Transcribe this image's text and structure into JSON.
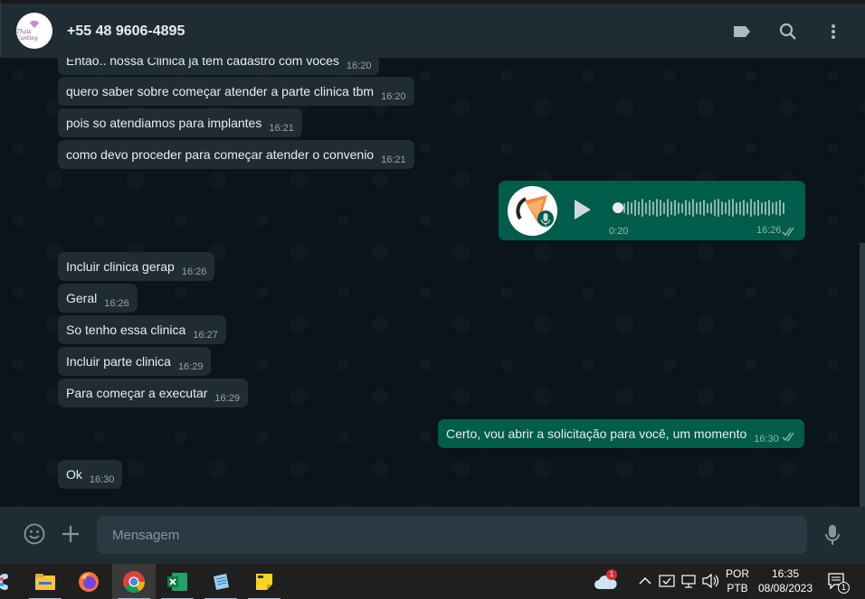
{
  "header": {
    "contact_name": "+55 48 9606-4895",
    "avatar_text": "Thais Cantieg",
    "icons": [
      "label-icon",
      "search-icon",
      "more-vertical-icon"
    ]
  },
  "messages": [
    {
      "dir": "in",
      "text": "Entao.. nossa Clinica já tem cadastro com voces",
      "time": "16:20"
    },
    {
      "dir": "in",
      "text": "quero saber sobre começar atender a parte clinica tbm",
      "time": "16:20"
    },
    {
      "dir": "in",
      "text": "pois so atendiamos para implantes",
      "time": "16:21"
    },
    {
      "dir": "in",
      "text": "como devo proceder para começar atender o convenio",
      "time": "16:21"
    },
    {
      "dir": "in",
      "text": "Incluir clinica gerap",
      "time": "16:26"
    },
    {
      "dir": "in",
      "text": "Geral",
      "time": "16:26"
    },
    {
      "dir": "in",
      "text": "So tenho essa clinica",
      "time": "16:27"
    },
    {
      "dir": "in",
      "text": "Incluir parte clinica",
      "time": "16:29"
    },
    {
      "dir": "in",
      "text": "Para começar a executar",
      "time": "16:29"
    },
    {
      "dir": "out",
      "text": "Certo, vou abrir a solicitação para você, um momento",
      "time": "16:30"
    },
    {
      "dir": "in",
      "text": "Ok",
      "time": "16:30"
    }
  ],
  "voice_message": {
    "duration": "0:20",
    "time": "16:26",
    "waveform": [
      0.5,
      0.7,
      0.6,
      0.8,
      0.7,
      0.9,
      0.6,
      0.8,
      0.7,
      0.9,
      0.8,
      0.6,
      0.9,
      0.7,
      0.8,
      0.6,
      0.5,
      0.8,
      0.7,
      0.9,
      0.6,
      0.7,
      0.8,
      0.5,
      0.6,
      0.8,
      0.9,
      0.7,
      0.6,
      0.8,
      0.9,
      0.6,
      0.7,
      0.8,
      0.6,
      0.9,
      0.7,
      0.8,
      0.6,
      0.7,
      0.8,
      0.6,
      0.7,
      0.8,
      0.6
    ]
  },
  "composer": {
    "placeholder": "Mensagem"
  },
  "taskbar": {
    "apps": [
      "paint-app",
      "file-explorer-app",
      "firefox-app",
      "chrome-app",
      "excel-app",
      "notepad-app",
      "sticky-notes-app"
    ],
    "weather_badge": "1",
    "language_top": "POR",
    "language_bottom": "PTB",
    "clock_time": "16:35",
    "clock_date": "08/08/2023",
    "notification_count": "1"
  },
  "colors": {
    "incoming_bubble": "#202c33",
    "outgoing_bubble": "#005c4b",
    "chat_background": "#0b141a",
    "header_background": "#202c33"
  }
}
